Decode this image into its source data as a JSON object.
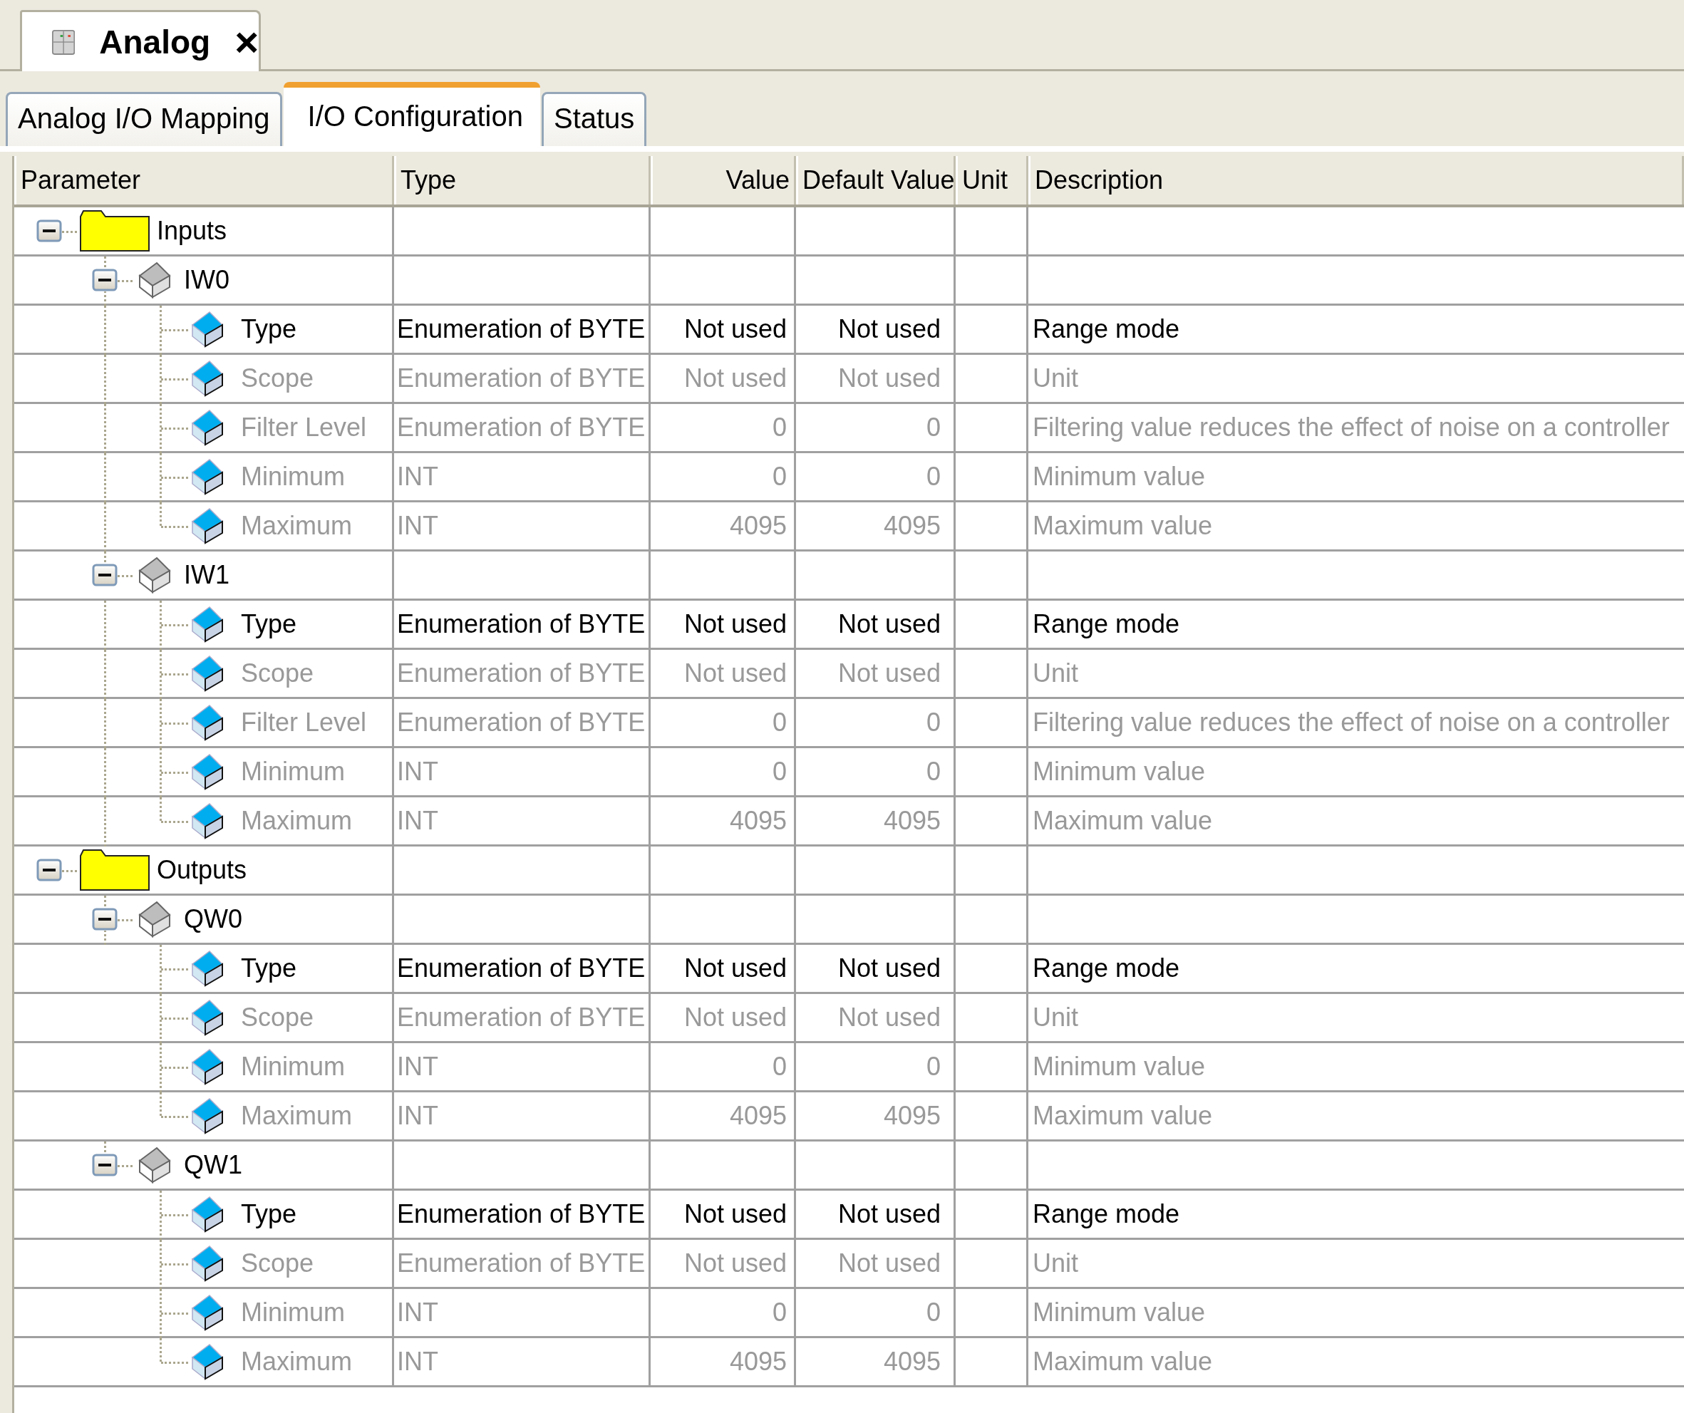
{
  "document_tab": {
    "title": "Analog",
    "close": "×"
  },
  "tabs": [
    {
      "label": "Analog I/O Mapping",
      "selected": false
    },
    {
      "label": "I/O Configuration",
      "selected": true
    },
    {
      "label": "Status",
      "selected": false
    }
  ],
  "columns": [
    "Parameter",
    "Type",
    "Value",
    "Default Value",
    "Unit",
    "Description"
  ],
  "tree": [
    {
      "label": "Inputs",
      "kind": "folder",
      "expanded": true,
      "children": [
        {
          "label": "IW0",
          "kind": "channel",
          "expanded": true,
          "children": [
            {
              "label": "Type",
              "kind": "parameter",
              "disabled": false,
              "type": "Enumeration of BYTE",
              "value": "Not used",
              "default": "Not used",
              "description": "Range mode"
            },
            {
              "label": "Scope",
              "kind": "parameter",
              "disabled": true,
              "type": "Enumeration of BYTE",
              "value": "Not used",
              "default": "Not used",
              "description": "Unit"
            },
            {
              "label": "Filter Level",
              "kind": "parameter",
              "disabled": true,
              "type": "Enumeration of BYTE",
              "value": "0",
              "default": "0",
              "description": "Filtering value reduces the effect of noise on a controller"
            },
            {
              "label": "Minimum",
              "kind": "parameter",
              "disabled": true,
              "type": "INT",
              "value": "0",
              "default": "0",
              "description": "Minimum value"
            },
            {
              "label": "Maximum",
              "kind": "parameter",
              "disabled": true,
              "type": "INT",
              "value": "4095",
              "default": "4095",
              "description": "Maximum value"
            }
          ]
        },
        {
          "label": "IW1",
          "kind": "channel",
          "expanded": true,
          "children": [
            {
              "label": "Type",
              "kind": "parameter",
              "disabled": false,
              "type": "Enumeration of BYTE",
              "value": "Not used",
              "default": "Not used",
              "description": "Range mode"
            },
            {
              "label": "Scope",
              "kind": "parameter",
              "disabled": true,
              "type": "Enumeration of BYTE",
              "value": "Not used",
              "default": "Not used",
              "description": "Unit"
            },
            {
              "label": "Filter Level",
              "kind": "parameter",
              "disabled": true,
              "type": "Enumeration of BYTE",
              "value": "0",
              "default": "0",
              "description": "Filtering value reduces the effect of noise on a controller"
            },
            {
              "label": "Minimum",
              "kind": "parameter",
              "disabled": true,
              "type": "INT",
              "value": "0",
              "default": "0",
              "description": "Minimum value"
            },
            {
              "label": "Maximum",
              "kind": "parameter",
              "disabled": true,
              "type": "INT",
              "value": "4095",
              "default": "4095",
              "description": "Maximum value"
            }
          ]
        }
      ]
    },
    {
      "label": "Outputs",
      "kind": "folder",
      "expanded": true,
      "children": [
        {
          "label": "QW0",
          "kind": "channel",
          "expanded": true,
          "children": [
            {
              "label": "Type",
              "kind": "parameter",
              "disabled": false,
              "type": "Enumeration of BYTE",
              "value": "Not used",
              "default": "Not used",
              "description": "Range mode"
            },
            {
              "label": "Scope",
              "kind": "parameter",
              "disabled": true,
              "type": "Enumeration of BYTE",
              "value": "Not used",
              "default": "Not used",
              "description": "Unit"
            },
            {
              "label": "Minimum",
              "kind": "parameter",
              "disabled": true,
              "type": "INT",
              "value": "0",
              "default": "0",
              "description": "Minimum value"
            },
            {
              "label": "Maximum",
              "kind": "parameter",
              "disabled": true,
              "type": "INT",
              "value": "4095",
              "default": "4095",
              "description": "Maximum value"
            }
          ]
        },
        {
          "label": "QW1",
          "kind": "channel",
          "expanded": true,
          "children": [
            {
              "label": "Type",
              "kind": "parameter",
              "disabled": false,
              "type": "Enumeration of BYTE",
              "value": "Not used",
              "default": "Not used",
              "description": "Range mode"
            },
            {
              "label": "Scope",
              "kind": "parameter",
              "disabled": true,
              "type": "Enumeration of BYTE",
              "value": "Not used",
              "default": "Not used",
              "description": "Unit"
            },
            {
              "label": "Minimum",
              "kind": "parameter",
              "disabled": true,
              "type": "INT",
              "value": "0",
              "default": "0",
              "description": "Minimum value"
            },
            {
              "label": "Maximum",
              "kind": "parameter",
              "disabled": true,
              "type": "INT",
              "value": "4095",
              "default": "4095",
              "description": "Maximum value"
            }
          ]
        }
      ]
    }
  ]
}
